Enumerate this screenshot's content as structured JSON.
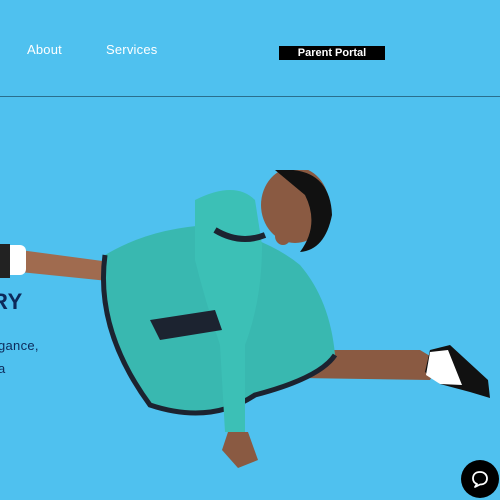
{
  "nav": {
    "about_label": "About",
    "services_label": "Services",
    "parent_portal_label": "Parent Portal"
  },
  "hero": {
    "heading": "RY",
    "line_1": "gance,",
    "line_2": "a"
  },
  "chat": {
    "icon": "chat-bubble-icon"
  },
  "colors": {
    "background": "#4fc1ef",
    "portal_button": "#000000",
    "heading_text": "#0d2a5a",
    "dress": "#39b8b0",
    "chat_button": "#000000"
  }
}
